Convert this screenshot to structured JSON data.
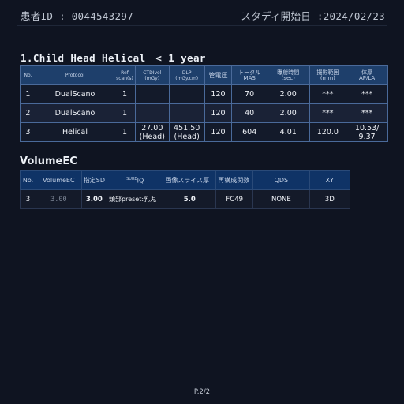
{
  "header": {
    "patient_id": "患者ID : 0044543297",
    "study_date": "スタディ開始日 :2024/02/23"
  },
  "section_title": "1.Child Head Helical　< 1 year",
  "protocol_table": {
    "headers": [
      "No.",
      "Protocol",
      "Ref\nscan(s)",
      "CTDIvol\n(mGy)",
      "DLP\n(mGy.cm)",
      "管電圧",
      "トータル\nMAS",
      "曝射時間\n(sec)",
      "撮影範囲\n(mm)",
      "体厚\nAP/LA"
    ],
    "rows": [
      [
        "1",
        "DualScano",
        "1",
        "",
        "",
        "120",
        "70",
        "2.00",
        "***",
        "***"
      ],
      [
        "2",
        "DualScano",
        "1",
        "",
        "",
        "120",
        "40",
        "2.00",
        "***",
        "***"
      ],
      [
        "3",
        "Helical",
        "1",
        "27.00\n(Head)",
        "451.50\n(Head)",
        "120",
        "604",
        "4.01",
        "120.0",
        "10.53/\n9.37"
      ]
    ]
  },
  "volume_title": "VolumeEC",
  "volume_table": {
    "headers": [
      "No.",
      "VolumeEC",
      "指定SD",
      "SURE IQ",
      "画像スライス厚",
      "再構成関数",
      "QDS",
      "XY"
    ],
    "row": [
      "3",
      "3.00",
      "3.00",
      "頭部preset:乳児",
      "5.0",
      "FC49",
      "NONE",
      "3D"
    ]
  },
  "footer": {
    "page": "P.2/2"
  }
}
